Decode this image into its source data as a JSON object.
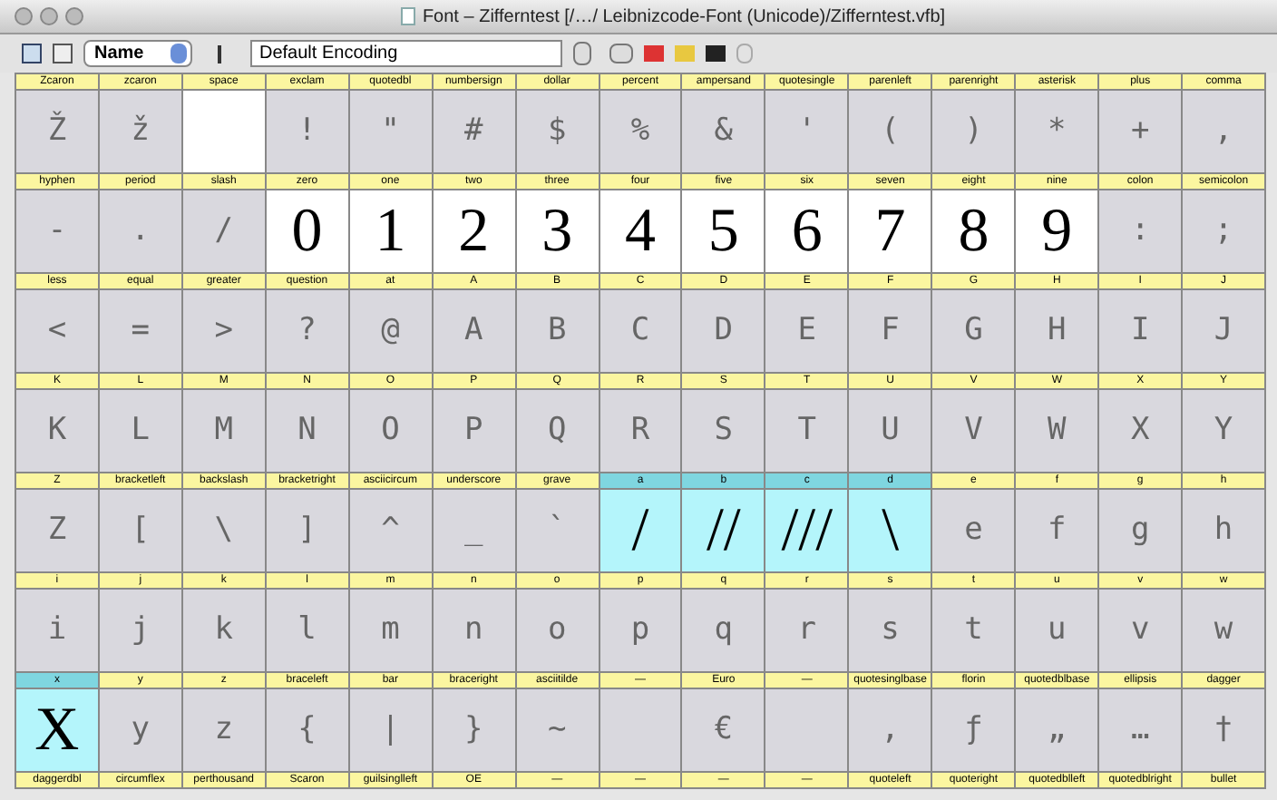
{
  "window": {
    "title": "Font – Zifferntest [/…/ Leibnizcode-Font (Unicode)/Zifferntest.vfb]"
  },
  "toolbar": {
    "caption_mode": "Name",
    "encoding": "Default Encoding"
  },
  "rows": [
    {
      "cells": [
        {
          "name": "Zcaron",
          "glyph": "Ž",
          "defined": false,
          "selected": false
        },
        {
          "name": "zcaron",
          "glyph": "ž",
          "defined": false,
          "selected": false
        },
        {
          "name": "space",
          "defined": true,
          "selected": false
        },
        {
          "name": "exclam",
          "glyph": "!",
          "defined": false,
          "selected": false
        },
        {
          "name": "quotedbl",
          "glyph": "\"",
          "defined": false,
          "selected": false
        },
        {
          "name": "numbersign",
          "glyph": "#",
          "defined": false,
          "selected": false
        },
        {
          "name": "dollar",
          "glyph": "$",
          "defined": false,
          "selected": false
        },
        {
          "name": "percent",
          "glyph": "%",
          "defined": false,
          "selected": false
        },
        {
          "name": "ampersand",
          "glyph": "&",
          "defined": false,
          "selected": false
        },
        {
          "name": "quotesingle",
          "glyph": "'",
          "defined": false,
          "selected": false
        },
        {
          "name": "parenleft",
          "glyph": "(",
          "defined": false,
          "selected": false
        },
        {
          "name": "parenright",
          "glyph": ")",
          "defined": false,
          "selected": false
        },
        {
          "name": "asterisk",
          "glyph": "*",
          "defined": false,
          "selected": false
        },
        {
          "name": "plus",
          "glyph": "+",
          "defined": false,
          "selected": false
        },
        {
          "name": "comma",
          "glyph": ",",
          "defined": false,
          "selected": false
        }
      ]
    },
    {
      "cells": [
        {
          "name": "hyphen",
          "glyph": "-",
          "defined": false,
          "selected": false
        },
        {
          "name": "period",
          "glyph": ".",
          "defined": false,
          "selected": false
        },
        {
          "name": "slash",
          "glyph": "/",
          "defined": false,
          "selected": false
        },
        {
          "name": "zero",
          "glyph": "0",
          "defined": true,
          "selected": false
        },
        {
          "name": "one",
          "glyph": "1",
          "defined": true,
          "selected": false
        },
        {
          "name": "two",
          "glyph": "2",
          "defined": true,
          "selected": false
        },
        {
          "name": "three",
          "glyph": "3",
          "defined": true,
          "selected": false
        },
        {
          "name": "four",
          "glyph": "4",
          "defined": true,
          "selected": false
        },
        {
          "name": "five",
          "glyph": "5",
          "defined": true,
          "selected": false
        },
        {
          "name": "six",
          "glyph": "6",
          "defined": true,
          "selected": false
        },
        {
          "name": "seven",
          "glyph": "7",
          "defined": true,
          "selected": false
        },
        {
          "name": "eight",
          "glyph": "8",
          "defined": true,
          "selected": false
        },
        {
          "name": "nine",
          "glyph": "9",
          "defined": true,
          "selected": false
        },
        {
          "name": "colon",
          "glyph": ":",
          "defined": false,
          "selected": false
        },
        {
          "name": "semicolon",
          "glyph": ";",
          "defined": false,
          "selected": false
        }
      ]
    },
    {
      "cells": [
        {
          "name": "less",
          "glyph": "<",
          "defined": false,
          "selected": false
        },
        {
          "name": "equal",
          "glyph": "=",
          "defined": false,
          "selected": false
        },
        {
          "name": "greater",
          "glyph": ">",
          "defined": false,
          "selected": false
        },
        {
          "name": "question",
          "glyph": "?",
          "defined": false,
          "selected": false
        },
        {
          "name": "at",
          "glyph": "@",
          "defined": false,
          "selected": false
        },
        {
          "name": "A",
          "glyph": "A",
          "defined": false,
          "selected": false
        },
        {
          "name": "B",
          "glyph": "B",
          "defined": false,
          "selected": false
        },
        {
          "name": "C",
          "glyph": "C",
          "defined": false,
          "selected": false
        },
        {
          "name": "D",
          "glyph": "D",
          "defined": false,
          "selected": false
        },
        {
          "name": "E",
          "glyph": "E",
          "defined": false,
          "selected": false
        },
        {
          "name": "F",
          "glyph": "F",
          "defined": false,
          "selected": false
        },
        {
          "name": "G",
          "glyph": "G",
          "defined": false,
          "selected": false
        },
        {
          "name": "H",
          "glyph": "H",
          "defined": false,
          "selected": false
        },
        {
          "name": "I",
          "glyph": "I",
          "defined": false,
          "selected": false
        },
        {
          "name": "J",
          "glyph": "J",
          "defined": false,
          "selected": false
        }
      ]
    },
    {
      "cells": [
        {
          "name": "K",
          "glyph": "K",
          "defined": false,
          "selected": false
        },
        {
          "name": "L",
          "glyph": "L",
          "defined": false,
          "selected": false
        },
        {
          "name": "M",
          "glyph": "M",
          "defined": false,
          "selected": false
        },
        {
          "name": "N",
          "glyph": "N",
          "defined": false,
          "selected": false
        },
        {
          "name": "O",
          "glyph": "O",
          "defined": false,
          "selected": false
        },
        {
          "name": "P",
          "glyph": "P",
          "defined": false,
          "selected": false
        },
        {
          "name": "Q",
          "glyph": "Q",
          "defined": false,
          "selected": false
        },
        {
          "name": "R",
          "glyph": "R",
          "defined": false,
          "selected": false
        },
        {
          "name": "S",
          "glyph": "S",
          "defined": false,
          "selected": false
        },
        {
          "name": "T",
          "glyph": "T",
          "defined": false,
          "selected": false
        },
        {
          "name": "U",
          "glyph": "U",
          "defined": false,
          "selected": false
        },
        {
          "name": "V",
          "glyph": "V",
          "defined": false,
          "selected": false
        },
        {
          "name": "W",
          "glyph": "W",
          "defined": false,
          "selected": false
        },
        {
          "name": "X",
          "glyph": "X",
          "defined": false,
          "selected": false
        },
        {
          "name": "Y",
          "glyph": "Y",
          "defined": false,
          "selected": false
        }
      ]
    },
    {
      "cells": [
        {
          "name": "Z",
          "glyph": "Z",
          "defined": false,
          "selected": false
        },
        {
          "name": "bracketleft",
          "glyph": "[",
          "defined": false,
          "selected": false
        },
        {
          "name": "backslash",
          "glyph": "\\",
          "defined": false,
          "selected": false
        },
        {
          "name": "bracketright",
          "glyph": "]",
          "defined": false,
          "selected": false
        },
        {
          "name": "asciicircum",
          "glyph": "^",
          "defined": false,
          "selected": false
        },
        {
          "name": "underscore",
          "glyph": "_",
          "defined": false,
          "selected": false
        },
        {
          "name": "grave",
          "glyph": "`",
          "defined": false,
          "selected": false
        },
        {
          "name": "a",
          "glyph": "/",
          "defined": true,
          "selected": true
        },
        {
          "name": "b",
          "glyph": "//",
          "defined": true,
          "selected": true
        },
        {
          "name": "c",
          "glyph": "///",
          "defined": true,
          "selected": true
        },
        {
          "name": "d",
          "glyph": "\\",
          "defined": true,
          "selected": true
        },
        {
          "name": "e",
          "glyph": "e",
          "defined": false,
          "selected": false
        },
        {
          "name": "f",
          "glyph": "f",
          "defined": false,
          "selected": false
        },
        {
          "name": "g",
          "glyph": "g",
          "defined": false,
          "selected": false
        },
        {
          "name": "h",
          "glyph": "h",
          "defined": false,
          "selected": false
        }
      ]
    },
    {
      "cells": [
        {
          "name": "i",
          "glyph": "i",
          "defined": false,
          "selected": false
        },
        {
          "name": "j",
          "glyph": "j",
          "defined": false,
          "selected": false
        },
        {
          "name": "k",
          "glyph": "k",
          "defined": false,
          "selected": false
        },
        {
          "name": "l",
          "glyph": "l",
          "defined": false,
          "selected": false
        },
        {
          "name": "m",
          "glyph": "m",
          "defined": false,
          "selected": false
        },
        {
          "name": "n",
          "glyph": "n",
          "defined": false,
          "selected": false
        },
        {
          "name": "o",
          "glyph": "o",
          "defined": false,
          "selected": false
        },
        {
          "name": "p",
          "glyph": "p",
          "defined": false,
          "selected": false
        },
        {
          "name": "q",
          "glyph": "q",
          "defined": false,
          "selected": false
        },
        {
          "name": "r",
          "glyph": "r",
          "defined": false,
          "selected": false
        },
        {
          "name": "s",
          "glyph": "s",
          "defined": false,
          "selected": false
        },
        {
          "name": "t",
          "glyph": "t",
          "defined": false,
          "selected": false
        },
        {
          "name": "u",
          "glyph": "u",
          "defined": false,
          "selected": false
        },
        {
          "name": "v",
          "glyph": "v",
          "defined": false,
          "selected": false
        },
        {
          "name": "w",
          "glyph": "w",
          "defined": false,
          "selected": false
        }
      ]
    },
    {
      "cells": [
        {
          "name": "x",
          "glyph": "X",
          "defined": true,
          "selected": true
        },
        {
          "name": "y",
          "glyph": "y",
          "defined": false,
          "selected": false
        },
        {
          "name": "z",
          "glyph": "z",
          "defined": false,
          "selected": false
        },
        {
          "name": "braceleft",
          "glyph": "{",
          "defined": false,
          "selected": false
        },
        {
          "name": "bar",
          "glyph": "|",
          "defined": false,
          "selected": false
        },
        {
          "name": "braceright",
          "glyph": "}",
          "defined": false,
          "selected": false
        },
        {
          "name": "asciitilde",
          "glyph": "~",
          "defined": false,
          "selected": false
        },
        {
          "name": "—",
          "defined": false,
          "selected": false
        },
        {
          "name": "Euro",
          "glyph": "€",
          "defined": false,
          "selected": false
        },
        {
          "name": "—",
          "defined": false,
          "selected": false
        },
        {
          "name": "quotesinglbase",
          "glyph": "‚",
          "defined": false,
          "selected": false
        },
        {
          "name": "florin",
          "glyph": "ƒ",
          "defined": false,
          "selected": false
        },
        {
          "name": "quotedblbase",
          "glyph": "„",
          "defined": false,
          "selected": false
        },
        {
          "name": "ellipsis",
          "glyph": "…",
          "defined": false,
          "selected": false
        },
        {
          "name": "dagger",
          "glyph": "†",
          "defined": false,
          "selected": false
        }
      ]
    }
  ],
  "partial_row": [
    "daggerdbl",
    "circumflex",
    "perthousand",
    "Scaron",
    "guilsinglleft",
    "OE",
    "—",
    "—",
    "—",
    "—",
    "quoteleft",
    "quoteright",
    "quotedblleft",
    "quotedblright",
    "bullet"
  ]
}
